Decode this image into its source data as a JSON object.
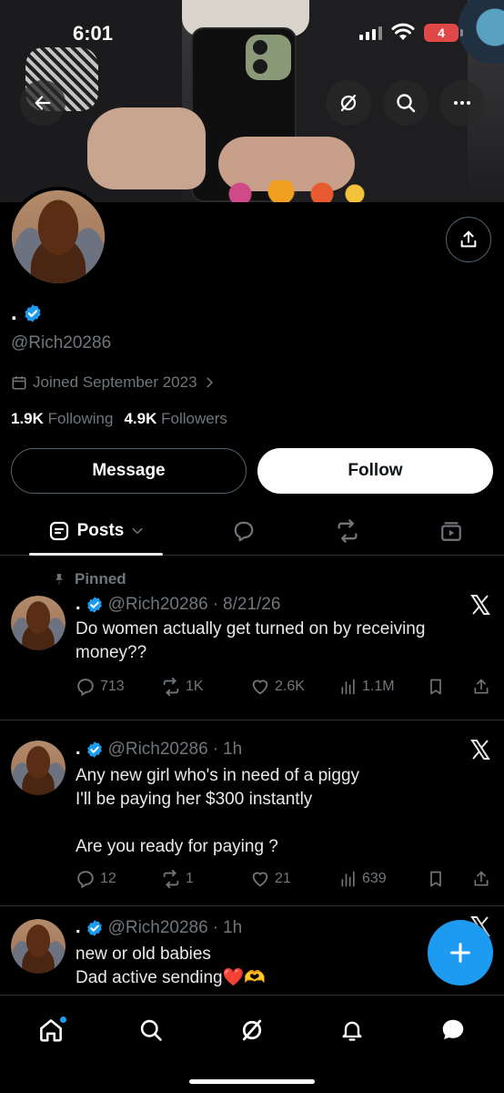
{
  "status_bar": {
    "time": "6:01",
    "battery": "4"
  },
  "profile": {
    "display_name": ".",
    "handle": "@Rich20286",
    "joined": "Joined September 2023",
    "following_count": "1.9K",
    "following_label": "Following",
    "followers_count": "4.9K",
    "followers_label": "Followers"
  },
  "buttons": {
    "message": "Message",
    "follow": "Follow"
  },
  "tabs": {
    "posts": "Posts"
  },
  "pinned_label": "Pinned",
  "posts": [
    {
      "name": ".",
      "handle": "@Rich20286",
      "time": "8/21/26",
      "text": "Do women actually get turned on by receiving money??",
      "replies": "713",
      "reposts": "1K",
      "likes": "2.6K",
      "views": "1.1M"
    },
    {
      "name": ".",
      "handle": "@Rich20286",
      "time": "1h",
      "text": "Any new girl who's in need of a piggy\nI'll be paying her $300 instantly\n\nAre you ready for paying ?",
      "replies": "12",
      "reposts": "1",
      "likes": "21",
      "views": "639"
    },
    {
      "name": ".",
      "handle": "@Rich20286",
      "time": "1h",
      "text": "new or old babies\nDad  active sending❤️🫶"
    }
  ],
  "colors": {
    "accent": "#1d9bf0",
    "background": "#000000",
    "muted": "#71767b"
  }
}
